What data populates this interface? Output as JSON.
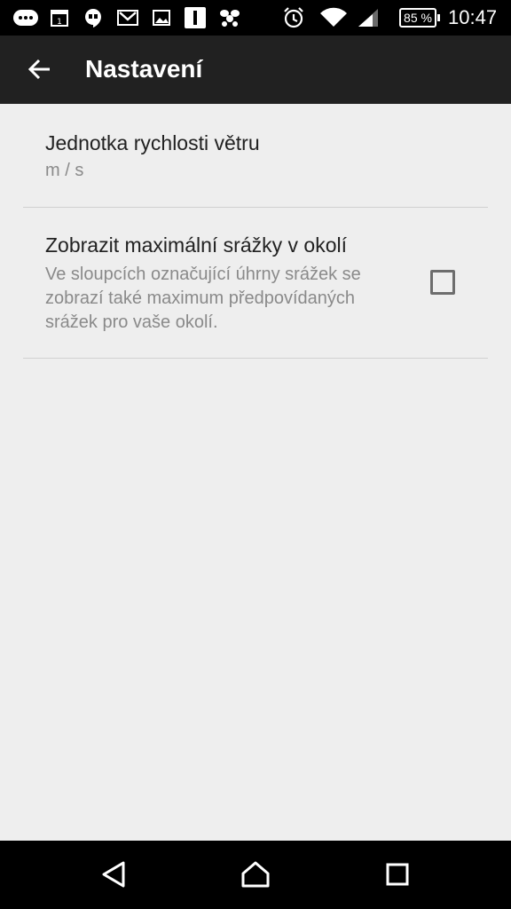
{
  "status_bar": {
    "battery": "85 %",
    "time": "10:47"
  },
  "app_bar": {
    "title": "Nastavení"
  },
  "preferences": [
    {
      "title": "Jednotka rychlosti větru",
      "summary": "m / s"
    },
    {
      "title": "Zobrazit maximální srážky v okolí",
      "summary_lines": [
        "Ve sloupcích označující úhrny srážek se",
        "zobrazí také maximum předpovídaných",
        "srážek pro vaše okolí."
      ],
      "checked": false
    }
  ],
  "colors": {
    "status_bar": "#000000",
    "app_bar": "#212121",
    "background": "#eeeeee",
    "title_text": "#212121",
    "summary_text": "#8a8a8a",
    "divider": "#d0d0d0"
  }
}
